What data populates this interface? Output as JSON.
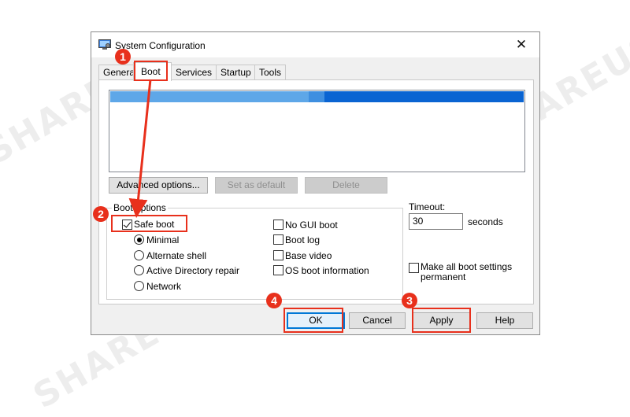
{
  "window": {
    "title": "System Configuration",
    "close_glyph": "✕",
    "app_icon": "monitor-gear-icon"
  },
  "tabs": [
    {
      "label": "General",
      "active": false
    },
    {
      "label": "Boot",
      "active": true
    },
    {
      "label": "Services",
      "active": false
    },
    {
      "label": "Startup",
      "active": false
    },
    {
      "label": "Tools",
      "active": false
    }
  ],
  "boot_list": {
    "selected_index": 0,
    "entries": [
      ""
    ]
  },
  "buttons": {
    "advanced": "Advanced options...",
    "set_default": "Set as default",
    "delete": "Delete",
    "ok": "OK",
    "cancel": "Cancel",
    "apply": "Apply",
    "help": "Help"
  },
  "boot_options": {
    "legend": "Boot options",
    "safe_boot": {
      "label": "Safe boot",
      "checked": true
    },
    "modes": [
      {
        "label": "Minimal",
        "selected": true
      },
      {
        "label": "Alternate shell",
        "selected": false
      },
      {
        "label": "Active Directory repair",
        "selected": false
      },
      {
        "label": "Network",
        "selected": false
      }
    ],
    "right_options": [
      {
        "label": "No GUI boot",
        "checked": false
      },
      {
        "label": "Boot log",
        "checked": false
      },
      {
        "label": "Base video",
        "checked": false
      },
      {
        "label": "OS boot information",
        "checked": false
      }
    ]
  },
  "timeout": {
    "label": "Timeout:",
    "value": "30",
    "unit": "seconds"
  },
  "make_permanent": {
    "label": "Make all boot settings permanent",
    "checked": false
  },
  "annotations": [
    {
      "number": "1",
      "target": "Boot tab"
    },
    {
      "number": "2",
      "target": "Safe boot"
    },
    {
      "number": "3",
      "target": "Apply"
    },
    {
      "number": "4",
      "target": "OK"
    }
  ],
  "colors": {
    "annotation": "#e8301c",
    "selection": "#0a64d2"
  }
}
